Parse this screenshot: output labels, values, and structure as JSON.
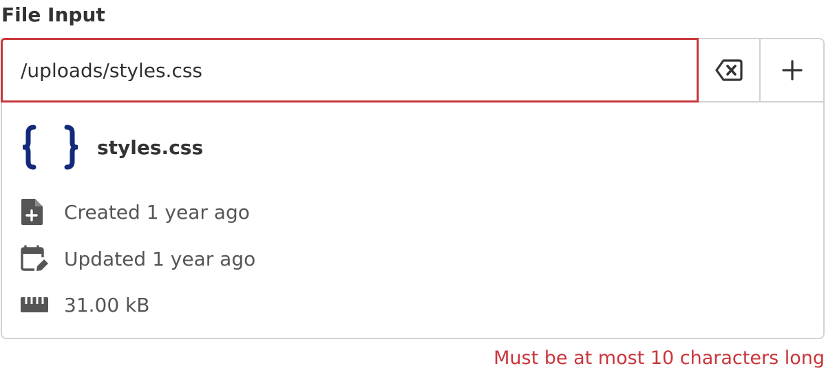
{
  "field": {
    "label": "File Input",
    "value": "/uploads/styles.css"
  },
  "buttons": {
    "clear_icon": "backspace-clear-icon",
    "add_icon": "plus-icon"
  },
  "file": {
    "type_icon": "code-braces-icon",
    "name": "styles.css",
    "created": "Created 1 year ago",
    "updated": "Updated 1 year ago",
    "size": "31.00 kB"
  },
  "icons": {
    "created": "file-plus-icon",
    "updated": "calendar-edit-icon",
    "size": "ruler-icon"
  },
  "validation": {
    "error": "Must be at most 10 characters long"
  },
  "colors": {
    "error": "#c9353a",
    "file_type_icon": "#132a7a",
    "border": "#d2d2d2"
  }
}
